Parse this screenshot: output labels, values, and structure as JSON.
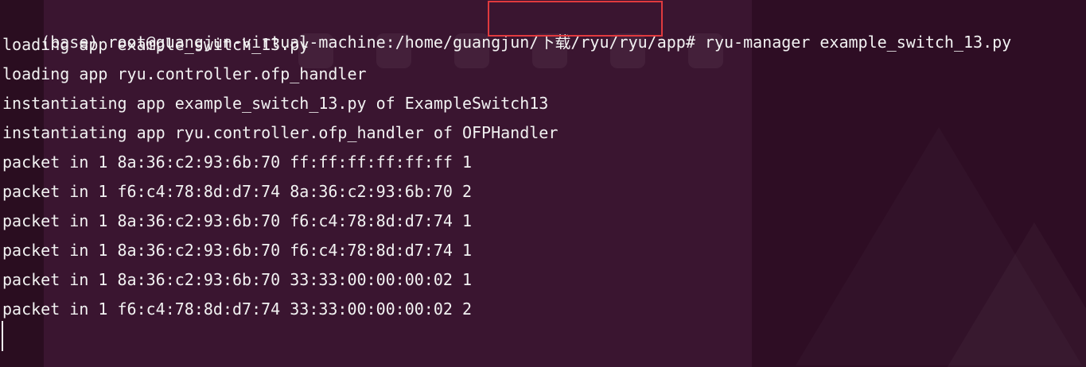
{
  "terminal": {
    "prompt": {
      "env": "(base) ",
      "user_host": "root@guangjun-virtual-machine:",
      "path_prefix": "/home/guangjun",
      "path_highlighted": "/下载/ryu/ryu/app#",
      "command": " ryu-manager example_switch_13.py"
    },
    "output_lines": [
      "loading app example_switch_13.py",
      "loading app ryu.controller.ofp_handler",
      "instantiating app example_switch_13.py of ExampleSwitch13",
      "instantiating app ryu.controller.ofp_handler of OFPHandler",
      "packet in 1 8a:36:c2:93:6b:70 ff:ff:ff:ff:ff:ff 1",
      "packet in 1 f6:c4:78:8d:d7:74 8a:36:c2:93:6b:70 2",
      "packet in 1 8a:36:c2:93:6b:70 f6:c4:78:8d:d7:74 1",
      "packet in 1 8a:36:c2:93:6b:70 f6:c4:78:8d:d7:74 1",
      "packet in 1 8a:36:c2:93:6b:70 33:33:00:00:00:02 1",
      "packet in 1 f6:c4:78:8d:d7:74 33:33:00:00:00:02 2"
    ]
  },
  "colors": {
    "text": "#f2f2f2",
    "highlight_border": "#e03a3e",
    "background": "#2c0f22"
  }
}
